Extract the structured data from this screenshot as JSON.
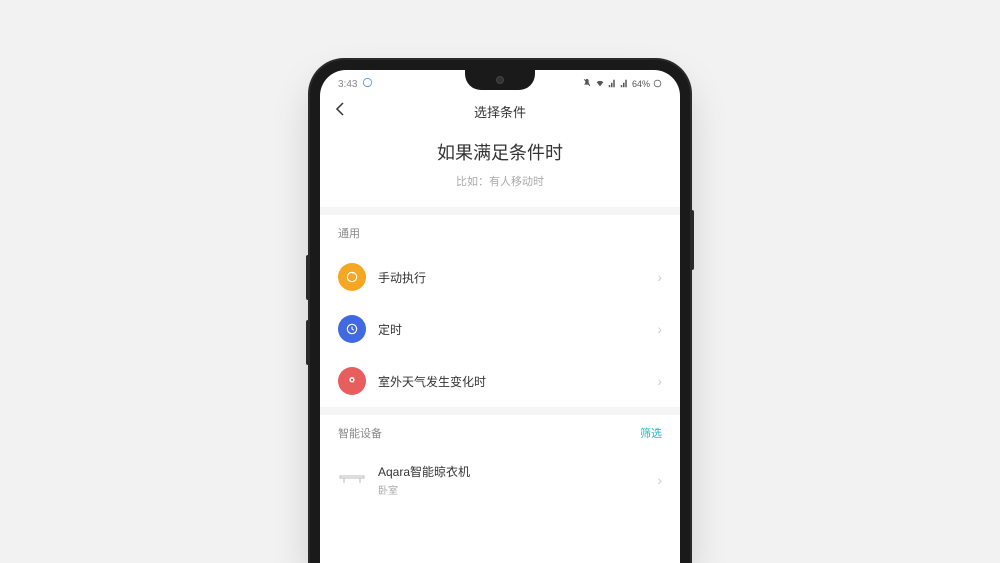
{
  "status_bar": {
    "time": "3:43",
    "battery": "64%"
  },
  "nav": {
    "title": "选择条件"
  },
  "header": {
    "title": "如果满足条件时",
    "subtitle": "比如：有人移动时"
  },
  "sections": {
    "general": {
      "title": "通用",
      "items": [
        {
          "label": "手动执行"
        },
        {
          "label": "定时"
        },
        {
          "label": "室外天气发生变化时"
        }
      ]
    },
    "devices": {
      "title": "智能设备",
      "filter": "筛选",
      "items": [
        {
          "label": "Aqara智能晾衣机",
          "sub": "卧室"
        }
      ]
    }
  }
}
